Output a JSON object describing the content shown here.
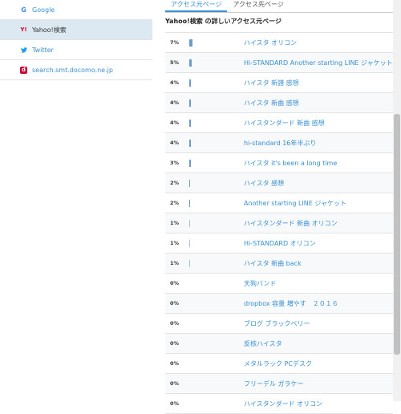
{
  "sources": [
    {
      "label": "Google",
      "icon": "google-icon",
      "active": false
    },
    {
      "label": "Yahoo!検索",
      "icon": "yahoo-icon",
      "active": true
    },
    {
      "label": "Twitter",
      "icon": "twitter-icon",
      "active": false
    },
    {
      "label": "search.smt.docomo.ne.jp",
      "icon": "docomo-icon",
      "active": false
    }
  ],
  "tabs": [
    {
      "label": "アクセス元ページ",
      "active": true
    },
    {
      "label": "アクセス先ページ",
      "active": false
    }
  ],
  "heading": "Yahoo!検索 の詳しいアクセス元ページ",
  "rows": [
    {
      "percent": "7%",
      "value": 7,
      "label": "ハイスタ オリコン"
    },
    {
      "percent": "5%",
      "value": 5,
      "label": "Hi-STANDARD Another starting LINE ジャケット"
    },
    {
      "percent": "4%",
      "value": 4,
      "label": "ハイスタ 新譜 感想"
    },
    {
      "percent": "4%",
      "value": 4,
      "label": "ハイスタ 新曲 感想"
    },
    {
      "percent": "4%",
      "value": 4,
      "label": "ハイスタンダード 新曲 感想"
    },
    {
      "percent": "4%",
      "value": 4,
      "label": "hi-standard 16年半ぶり"
    },
    {
      "percent": "3%",
      "value": 3,
      "label": "ハイスタ it's been a long time"
    },
    {
      "percent": "2%",
      "value": 2,
      "label": "ハイスタ 感想"
    },
    {
      "percent": "2%",
      "value": 2,
      "label": "Another starting LINE ジャケット"
    },
    {
      "percent": "1%",
      "value": 1,
      "label": "ハイスタンダード 新曲 オリコン"
    },
    {
      "percent": "1%",
      "value": 1,
      "label": "Hi-STANDARD オリコン"
    },
    {
      "percent": "1%",
      "value": 1,
      "label": "ハイスタ 新曲 back"
    },
    {
      "percent": "0%",
      "value": 0,
      "label": "天狗バンド"
    },
    {
      "percent": "0%",
      "value": 0,
      "label": "dropbox 容量 増やす　２０１６"
    },
    {
      "percent": "0%",
      "value": 0,
      "label": "ブログ ブラックベリー"
    },
    {
      "percent": "0%",
      "value": 0,
      "label": "反核ハイスタ"
    },
    {
      "percent": "0%",
      "value": 0,
      "label": "メタルラック PCデスク"
    },
    {
      "percent": "0%",
      "value": 0,
      "label": "フリーデル ガラケー"
    },
    {
      "percent": "0%",
      "value": 0,
      "label": "ハイスタンダード オリコン"
    }
  ]
}
